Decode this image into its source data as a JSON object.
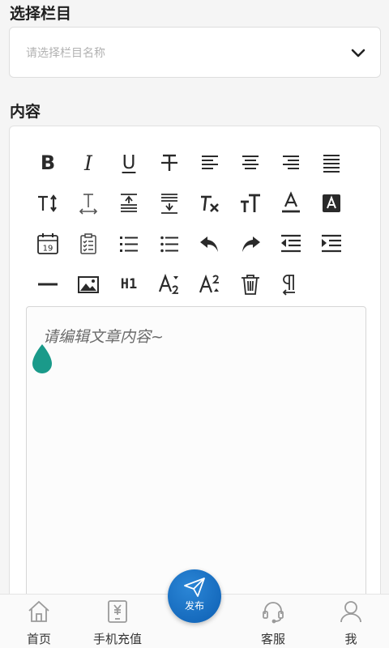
{
  "column_section": {
    "title": "选择栏目",
    "select_placeholder": "请选择栏目名称",
    "chevron_icon": "chevron-down-icon"
  },
  "content_section": {
    "title": "内容",
    "editor_placeholder": "请编辑文章内容~"
  },
  "toolbar": {
    "rows": [
      [
        "bold",
        "italic",
        "underline",
        "strikethrough",
        "align-left",
        "align-center",
        "align-right",
        "align-justify"
      ],
      [
        "line-height",
        "letter-spacing",
        "paragraph-spacing-before",
        "paragraph-spacing-after",
        "clear-format",
        "font-size",
        "font-color",
        "background-color"
      ],
      [
        "insert-date",
        "checklist",
        "ordered-list",
        "unordered-list",
        "undo",
        "redo",
        "outdent",
        "indent"
      ],
      [
        "horizontal-rule",
        "insert-image",
        "heading-1",
        "subscript",
        "superscript",
        "delete",
        "paragraph-direction"
      ]
    ],
    "labels": {
      "bold": "B",
      "italic": "I",
      "underline": "U",
      "heading-1": "H1",
      "calendar_day": "19"
    }
  },
  "bottom_nav": {
    "home": "首页",
    "recharge": "手机充值",
    "publish": "发布",
    "service": "客服",
    "me": "我"
  },
  "colors": {
    "publish_button": "#1a6fc4",
    "cursor_handle": "#1a9a8a",
    "icon": "#2a2a2a",
    "nav_icon": "#9a9a9a"
  }
}
